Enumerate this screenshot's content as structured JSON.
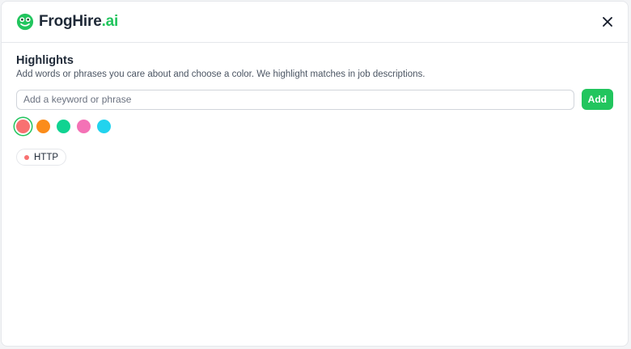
{
  "header": {
    "brand_name": "FrogHire",
    "brand_tld": ".ai",
    "logo_icon": "frog-icon",
    "close_icon": "close-icon"
  },
  "highlights": {
    "title": "Highlights",
    "description": "Add words or phrases you care about and choose a color. We highlight matches in job descriptions.",
    "input": {
      "value": "",
      "placeholder": "Add a keyword or phrase"
    },
    "add_label": "Add",
    "colors": [
      {
        "name": "red",
        "hex": "#f87171",
        "selected": true
      },
      {
        "name": "orange",
        "hex": "#fb8c1a",
        "selected": false
      },
      {
        "name": "green",
        "hex": "#10d391",
        "selected": false
      },
      {
        "name": "pink",
        "hex": "#f472b6",
        "selected": false
      },
      {
        "name": "cyan",
        "hex": "#22d3ee",
        "selected": false
      }
    ],
    "keywords": [
      {
        "label": "HTTP",
        "color": "#f87171"
      }
    ]
  },
  "theme": {
    "accent": "#22c55e",
    "text": "#1f2937",
    "muted": "#4b5563",
    "border": "#e5e7eb"
  }
}
